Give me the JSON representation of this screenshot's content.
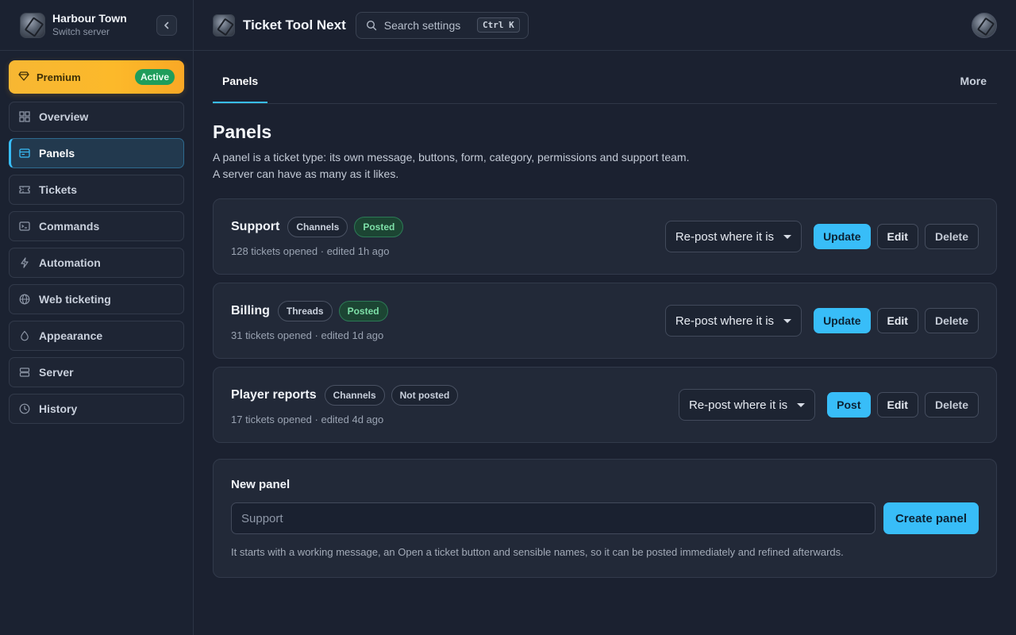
{
  "server": {
    "name": "Harbour Town",
    "subtitle": "Switch server"
  },
  "premium": {
    "label": "Premium",
    "badge": "Active"
  },
  "sidebar": {
    "items": [
      {
        "label": "Overview",
        "icon": "grid-icon"
      },
      {
        "label": "Panels",
        "icon": "panel-icon",
        "active": true
      },
      {
        "label": "Tickets",
        "icon": "ticket-icon"
      },
      {
        "label": "Commands",
        "icon": "terminal-icon"
      },
      {
        "label": "Automation",
        "icon": "lightning-icon"
      },
      {
        "label": "Web ticketing",
        "icon": "globe-icon"
      },
      {
        "label": "Appearance",
        "icon": "droplet-icon"
      },
      {
        "label": "Server",
        "icon": "server-icon"
      },
      {
        "label": "History",
        "icon": "clock-icon"
      }
    ]
  },
  "header": {
    "title": "Ticket Tool Next",
    "search_placeholder": "Search settings",
    "search_shortcut": "Ctrl K"
  },
  "tabs": {
    "active": "Panels",
    "more": "More"
  },
  "page": {
    "title": "Panels",
    "desc_line1": "A panel is a ticket type: its own message, buttons, form, category, permissions and support team.",
    "desc_line2": "A server can have as many as it likes."
  },
  "panels": [
    {
      "name": "Support",
      "type": "Channels",
      "status": "Posted",
      "meta": "128 tickets opened · edited 1h ago",
      "select": "Re-post where it is",
      "primary": "Update",
      "edit": "Edit",
      "delete": "Delete"
    },
    {
      "name": "Billing",
      "type": "Threads",
      "status": "Posted",
      "meta": "31 tickets opened · edited 1d ago",
      "select": "Re-post where it is",
      "primary": "Update",
      "edit": "Edit",
      "delete": "Delete"
    },
    {
      "name": "Player reports",
      "type": "Channels",
      "status": "Not posted",
      "meta": "17 tickets opened · edited 4d ago",
      "select": "Re-post where it is",
      "primary": "Post",
      "edit": "Edit",
      "delete": "Delete"
    }
  ],
  "new_panel": {
    "title": "New panel",
    "placeholder": "Support",
    "button": "Create panel",
    "hint": "It starts with a working message, an Open a ticket button and sensible names, so it can be posted immediately and refined afterwards."
  },
  "colors": {
    "accent": "#38bdf8",
    "premium": "#fcb92a",
    "success": "#1f9d5b"
  }
}
